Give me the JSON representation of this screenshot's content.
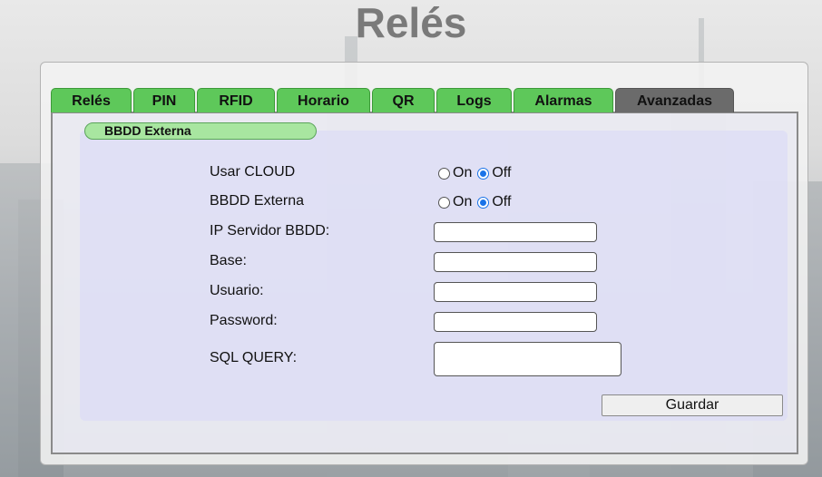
{
  "page": {
    "title": "Relés"
  },
  "tabs": [
    {
      "label": "Relés",
      "active": false
    },
    {
      "label": "PIN",
      "active": false
    },
    {
      "label": "RFID",
      "active": false
    },
    {
      "label": "Horario",
      "active": false
    },
    {
      "label": "QR",
      "active": false
    },
    {
      "label": "Logs",
      "active": false
    },
    {
      "label": "Alarmas",
      "active": false
    },
    {
      "label": "Avanzadas",
      "active": true
    }
  ],
  "section": {
    "label": "BBDD Externa"
  },
  "form": {
    "usar_cloud": {
      "label": "Usar CLOUD",
      "on_label": "On",
      "off_label": "Off",
      "value": "Off"
    },
    "bbdd_externa": {
      "label": "BBDD Externa",
      "on_label": "On",
      "off_label": "Off",
      "value": "Off"
    },
    "ip_servidor": {
      "label": "IP Servidor BBDD:",
      "value": ""
    },
    "base": {
      "label": "Base:",
      "value": ""
    },
    "usuario": {
      "label": "Usuario:",
      "value": ""
    },
    "password": {
      "label": "Password:",
      "value": ""
    },
    "sql_query": {
      "label": "SQL QUERY:",
      "value": ""
    },
    "save_label": "Guardar"
  },
  "colors": {
    "tab_green": "#5ec85a",
    "tab_active": "#6b6b6b",
    "section_green": "#a8e6a0",
    "radio_accent": "#1a73e8",
    "title_gray": "#7a7a7a"
  }
}
